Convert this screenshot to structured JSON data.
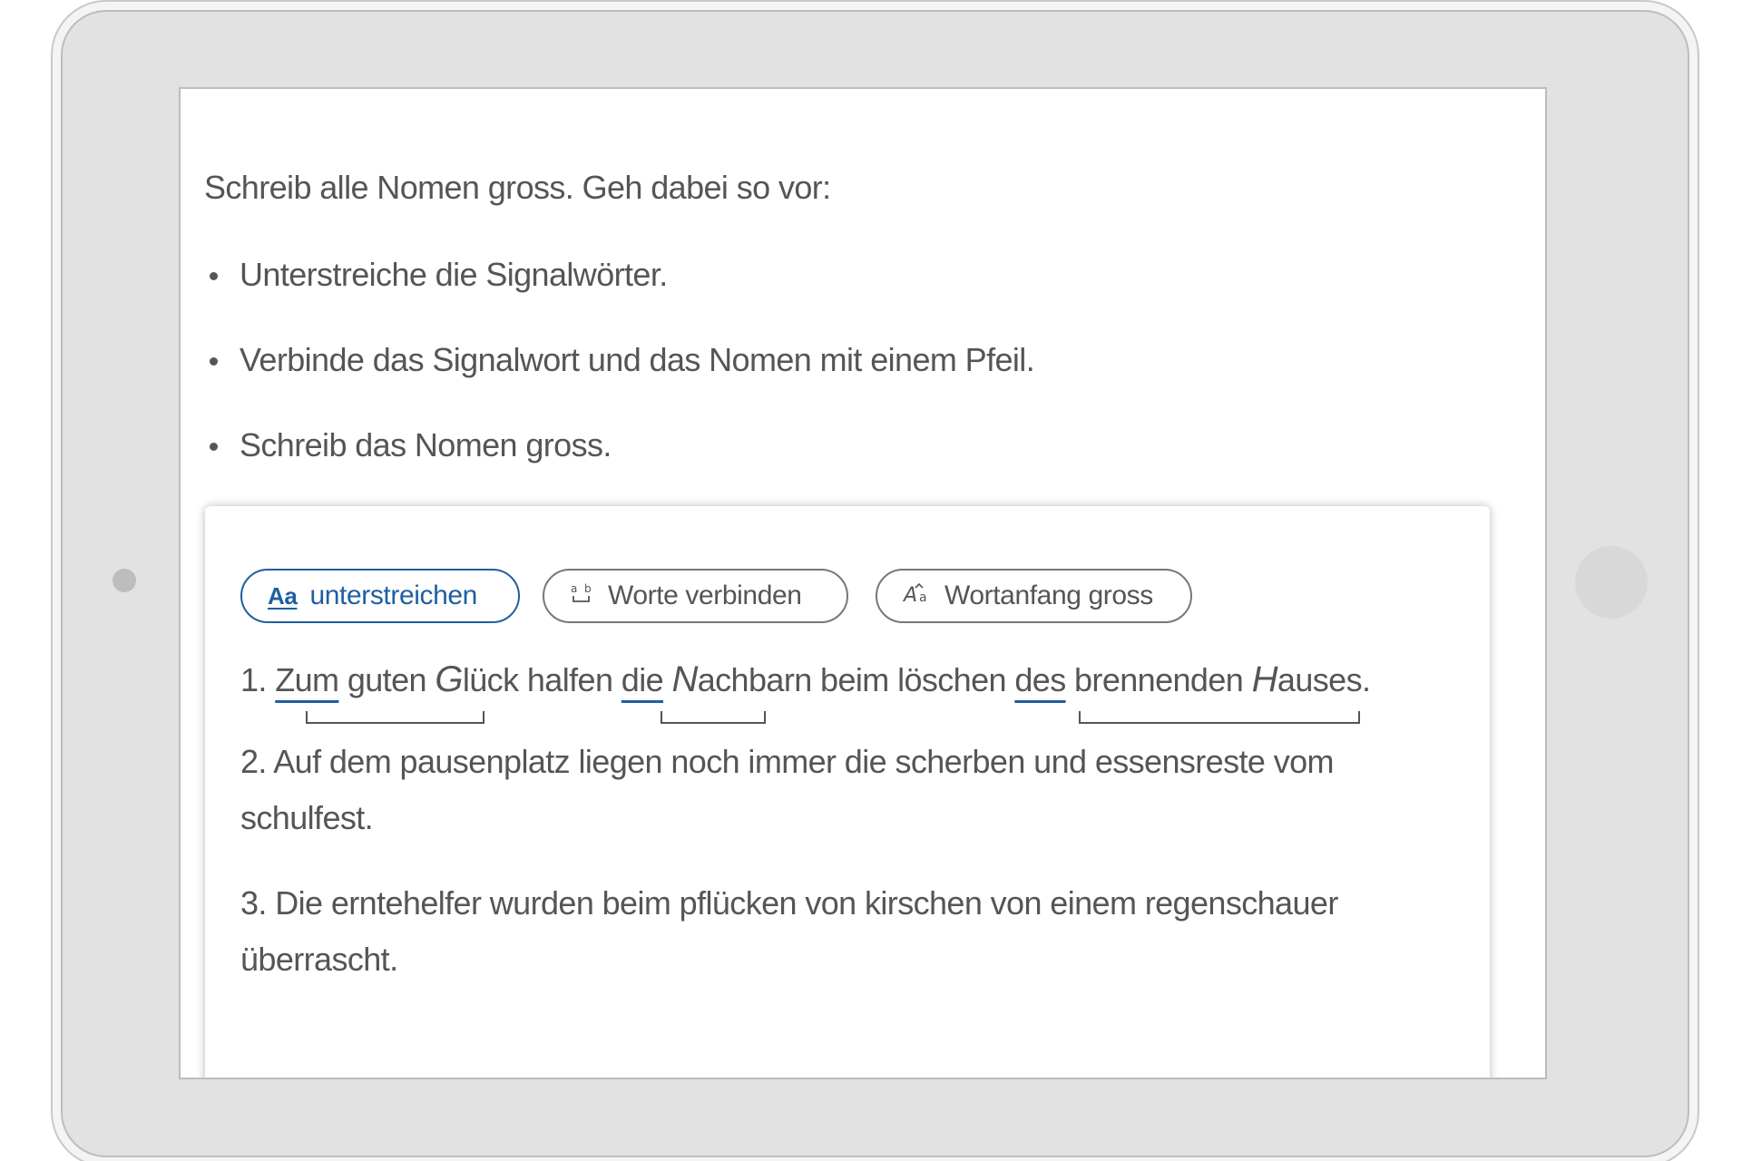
{
  "instructions": {
    "title": "Schreib alle Nomen gross. Geh dabei so vor:",
    "steps": [
      "Unterstreiche die Signalwörter.",
      "Verbinde das Signalwort und das Nomen mit einem Pfeil.",
      "Schreib das Nomen gross."
    ]
  },
  "toolbar": {
    "underline_icon": "Aa",
    "underline_label": "unterstreichen",
    "connect_icon": "connect-words-icon",
    "connect_label": "Worte verbinden",
    "capitalize_icon": "capitalize-icon",
    "capitalize_label": "Wortanfang gross",
    "active_tool": "unterstreichen"
  },
  "exercises": [
    {
      "number": "1.",
      "parts": {
        "signal1": "Zum",
        "t1": " guten ",
        "cap1": "G",
        "t2": "lück halfen ",
        "signal2": "die",
        "t3": " ",
        "cap2": "N",
        "t4": "achbarn beim löschen ",
        "signal3": "des",
        "t5": " brennenden ",
        "cap3": "H",
        "t6": "auses."
      }
    },
    {
      "number": "2.",
      "text": "Auf dem pausenplatz liegen noch immer die scherben und essensreste vom schulfest."
    },
    {
      "number": "3.",
      "text": "Die erntehelfer wurden beim pflücken von kirschen von einem regenschauer überrascht."
    }
  ],
  "colors": {
    "accent": "#1f5fa0",
    "text": "#555555",
    "device_frame": "#e2e2e2"
  }
}
